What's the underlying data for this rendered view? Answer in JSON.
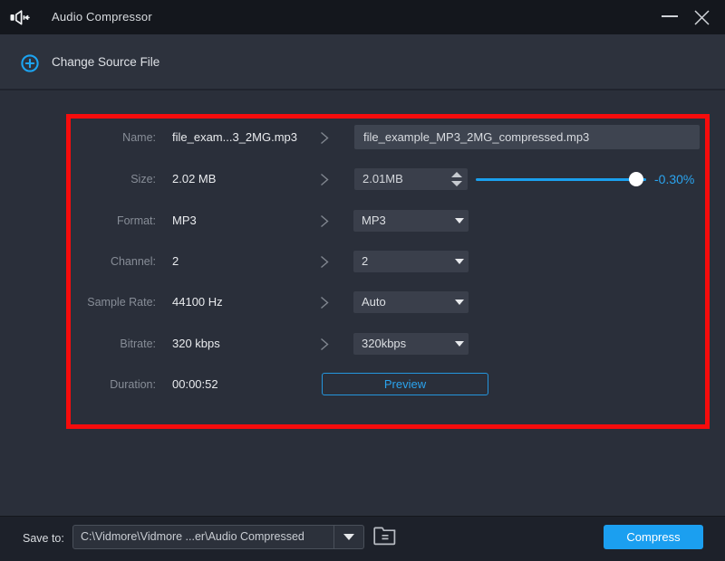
{
  "window": {
    "title": "Audio Compressor"
  },
  "header": {
    "change_source_label": "Change Source File"
  },
  "form": {
    "rows": [
      {
        "label": "Name:",
        "value": "file_exam...3_2MG.mp3",
        "control": "text",
        "text": "file_example_MP3_2MG_compressed.mp3"
      },
      {
        "label": "Size:",
        "value": "2.02 MB",
        "control": "spinner",
        "text": "2.01MB",
        "reduction": "-0.30%"
      },
      {
        "label": "Format:",
        "value": "MP3",
        "control": "dropdown",
        "text": "MP3"
      },
      {
        "label": "Channel:",
        "value": "2",
        "control": "dropdown",
        "text": "2"
      },
      {
        "label": "Sample Rate:",
        "value": "44100 Hz",
        "control": "dropdown",
        "text": "Auto"
      },
      {
        "label": "Bitrate:",
        "value": "320 kbps",
        "control": "dropdown",
        "text": "320kbps"
      },
      {
        "label": "Duration:",
        "value": "00:00:52",
        "control": "button",
        "text": "Preview"
      }
    ]
  },
  "footer": {
    "save_to_label": "Save to:",
    "path_value": "C:\\Vidmore\\Vidmore ...er\\Audio Compressed",
    "compress_label": "Compress"
  },
  "colors": {
    "accent_blue": "#1aa0ee",
    "annotation_red": "#f60c0c",
    "compress_button": "#1b9ff0"
  }
}
